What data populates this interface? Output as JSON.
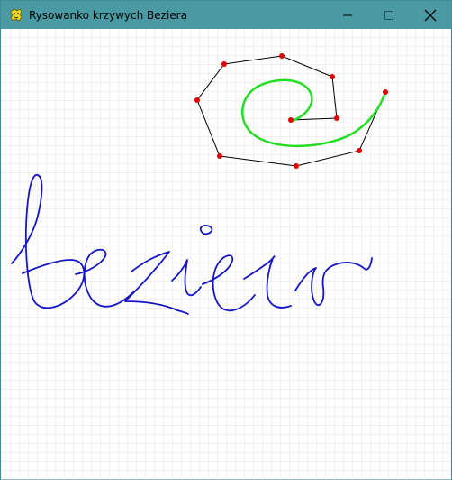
{
  "window": {
    "title": "Rysowanko krzywych Beziera",
    "app_icon": "pygame-snake-icon",
    "controls": [
      "minimize-icon",
      "maximize-icon",
      "close-icon"
    ]
  },
  "canvas": {
    "background": "#ffffff",
    "grid_color": "#e3e3e3",
    "control_point_color": "#e00000",
    "control_polygon_color": "#000000",
    "spiral_curve_color": "#22dd22",
    "handwriting_color": "#1515c8",
    "handwriting_text": "bezier"
  }
}
